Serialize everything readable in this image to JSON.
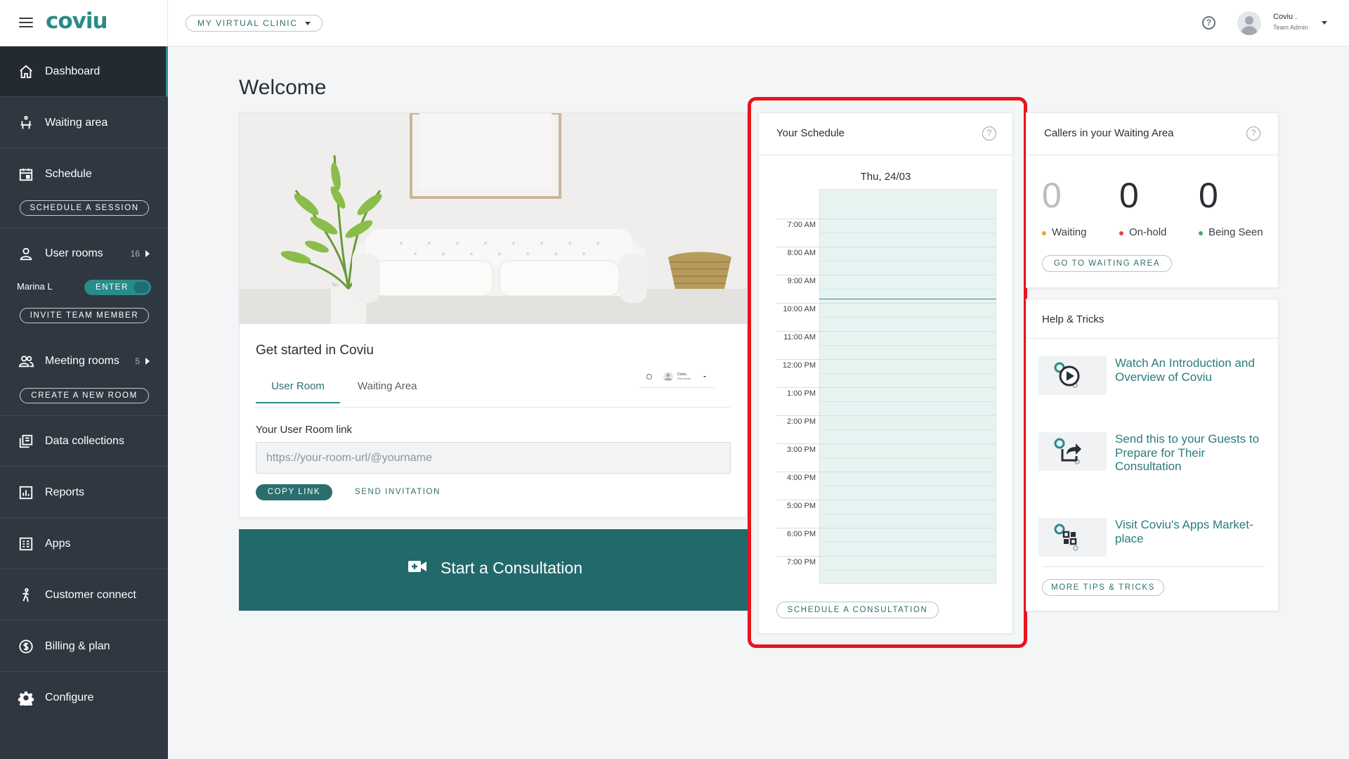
{
  "brand": {
    "logo_text": "coviu"
  },
  "topbar": {
    "clinic_selector": "MY VIRTUAL CLINIC",
    "user_name": "Coviu .",
    "user_role": "Team Admin"
  },
  "sidebar": {
    "items": [
      {
        "label": "Dashboard",
        "icon": "home-icon",
        "active": true
      },
      {
        "label": "Waiting area",
        "icon": "waiting-chair-icon"
      },
      {
        "label": "Schedule",
        "icon": "calendar-icon",
        "action": "SCHEDULE A SESSION"
      },
      {
        "label": "User rooms",
        "icon": "user-icon",
        "count": "16"
      },
      {
        "label": "Meeting rooms",
        "icon": "group-icon",
        "count": "5",
        "action": "CREATE A NEW ROOM"
      },
      {
        "label": "Data collections",
        "icon": "collections-icon"
      },
      {
        "label": "Reports",
        "icon": "bar-chart-icon"
      },
      {
        "label": "Apps",
        "icon": "apps-icon"
      },
      {
        "label": "Customer connect",
        "icon": "person-walking-icon"
      },
      {
        "label": "Billing & plan",
        "icon": "dollar-circle-icon"
      },
      {
        "label": "Configure",
        "icon": "gear-icon"
      }
    ],
    "user_room": {
      "name": "Marina L",
      "enter_label": "ENTER",
      "invite_label": "INVITE TEAM MEMBER"
    }
  },
  "main": {
    "welcome": "Welcome",
    "get_started": {
      "title": "Get started in Coviu",
      "tabs": [
        "User Room",
        "Waiting Area"
      ],
      "active_tab": "User Room",
      "link_label": "Your User Room link",
      "link_placeholder": "https://your-room-url/@yourname",
      "copy_label": "COPY LINK",
      "send_label": "SEND INVITATION",
      "mini_user_name": "Coviu",
      "mini_user_role": "Team Admin"
    },
    "start_consultation": "Start a Consultation",
    "schedule": {
      "title": "Your Schedule",
      "date": "Thu, 24/03",
      "times": [
        "7:00 AM",
        "8:00 AM",
        "9:00 AM",
        "10:00 AM",
        "11:00 AM",
        "12:00 PM",
        "1:00 PM",
        "2:00 PM",
        "3:00 PM",
        "4:00 PM",
        "5:00 PM",
        "6:00 PM",
        "7:00 PM"
      ],
      "button": "SCHEDULE A CONSULTATION"
    },
    "callers": {
      "title": "Callers in your Waiting Area",
      "stats": [
        {
          "value": "0",
          "label": "Waiting",
          "dot_color": "#f0a23a",
          "num_color": "#b8bec4"
        },
        {
          "value": "0",
          "label": "On-hold",
          "dot_color": "#e0453f",
          "num_color": "#2b2f33"
        },
        {
          "value": "0",
          "label": "Being Seen",
          "dot_color": "#3fae6a",
          "num_color": "#2b2f33"
        }
      ],
      "button": "GO TO WAITING AREA"
    },
    "help": {
      "title": "Help & Tricks",
      "tips": [
        {
          "text": "Watch An Introduction and Overview of Coviu",
          "icon": "play-icon"
        },
        {
          "text": "Send this to your Guests to Prepare for Their Consultation",
          "icon": "share-icon"
        },
        {
          "text": "Visit Coviu's Apps Market-place",
          "icon": "apps-grid-icon"
        }
      ],
      "button": "MORE TIPS & TRICKS"
    }
  },
  "colors": {
    "accent": "#2a8b8a",
    "sidebar": "#2f3740",
    "highlight": "#e8141c"
  }
}
